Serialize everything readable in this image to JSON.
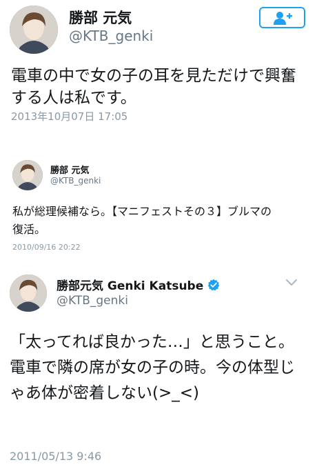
{
  "tweets": [
    {
      "name": "勝部 元気",
      "handle": "@KTB_genki",
      "text": "電車の中で女の子の耳を見ただけで興奮する人は私です。",
      "time": "2013年10月07日 17:05",
      "follow_icon": "add-user-icon"
    },
    {
      "name": "勝部 元気",
      "handle": "@KTB_genki",
      "text": "私が総理候補なら。【マニフェストその３】ブルマの復活。",
      "time": "2010/09/16 20:22"
    },
    {
      "name": "勝部元気 Genki Katsube",
      "handle": "@KTB_genki",
      "text": "「太ってれば良かった…」と思うこと。電車で隣の席が女の子の時。今の体型じゃあ体が密着しない(>_<)",
      "time": "2011/05/13 9:46",
      "verified_icon": "verified-badge-icon",
      "menu_icon": "chevron-down-icon"
    }
  ],
  "colors": {
    "accent": "#1da1f2",
    "muted": "#657786",
    "timestamp": "#8899a6"
  }
}
